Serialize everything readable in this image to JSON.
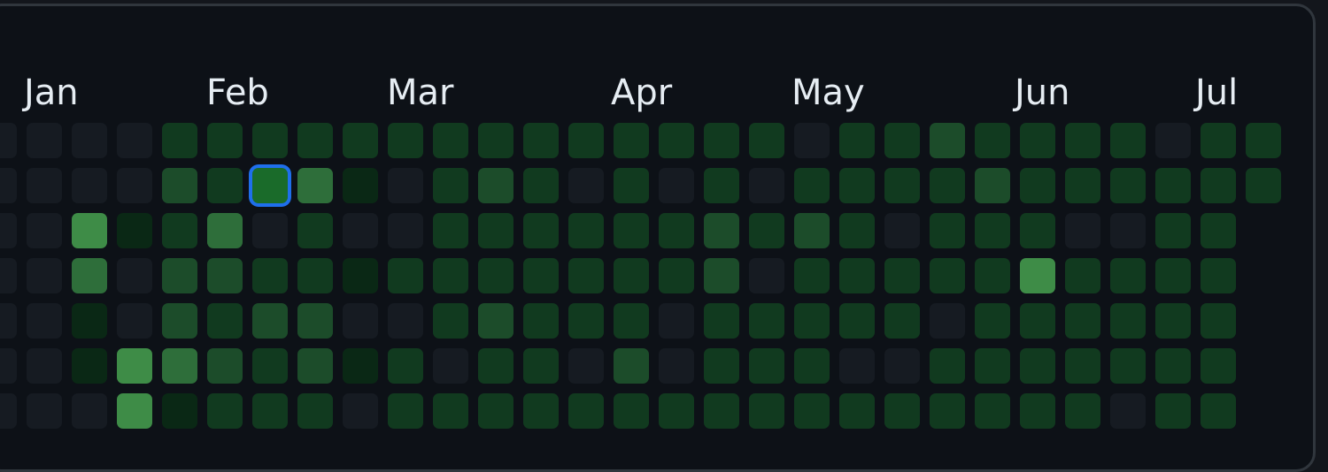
{
  "calendar": {
    "months": [
      "Jan",
      "Feb",
      "Mar",
      "Apr",
      "May",
      "Jun",
      "Jul"
    ],
    "colors": {
      "level0": "#161b22",
      "level1": "#0a2815",
      "level2": "#113a1f",
      "level3": "#1c4c2a",
      "level4": "#2e6e3a",
      "level5": "#3e8c47",
      "selected_outline": "#1f6feb",
      "selected_fill": "#1a6b2a"
    },
    "selected_week": 6,
    "selected_day": 1,
    "weeks": [
      [
        0,
        0,
        0,
        0,
        0,
        0,
        0
      ],
      [
        0,
        0,
        0,
        0,
        0,
        0,
        0
      ],
      [
        0,
        0,
        5,
        4,
        1,
        1,
        0
      ],
      [
        0,
        0,
        1,
        0,
        0,
        5,
        5
      ],
      [
        2,
        3,
        2,
        3,
        3,
        4,
        1
      ],
      [
        2,
        2,
        4,
        3,
        2,
        3,
        2
      ],
      [
        2,
        1,
        0,
        2,
        3,
        2,
        2
      ],
      [
        2,
        4,
        2,
        2,
        3,
        3,
        2
      ],
      [
        2,
        1,
        0,
        1,
        0,
        1,
        0
      ],
      [
        2,
        0,
        0,
        2,
        0,
        2,
        2
      ],
      [
        2,
        2,
        2,
        2,
        2,
        0,
        2
      ],
      [
        2,
        3,
        2,
        2,
        3,
        2,
        2
      ],
      [
        2,
        2,
        2,
        2,
        2,
        2,
        2
      ],
      [
        2,
        0,
        2,
        2,
        2,
        0,
        2
      ],
      [
        2,
        2,
        2,
        2,
        2,
        3,
        2
      ],
      [
        2,
        0,
        2,
        2,
        0,
        0,
        2
      ],
      [
        2,
        2,
        3,
        3,
        2,
        2,
        2
      ],
      [
        2,
        0,
        2,
        0,
        2,
        2,
        2
      ],
      [
        0,
        2,
        3,
        2,
        2,
        2,
        2
      ],
      [
        2,
        2,
        2,
        2,
        2,
        0,
        2
      ],
      [
        2,
        2,
        0,
        2,
        2,
        0,
        2
      ],
      [
        3,
        2,
        2,
        2,
        0,
        2,
        2
      ],
      [
        2,
        3,
        2,
        2,
        2,
        2,
        2
      ],
      [
        2,
        2,
        2,
        5,
        2,
        2,
        2
      ],
      [
        2,
        2,
        0,
        2,
        2,
        2,
        2
      ],
      [
        2,
        2,
        0,
        2,
        2,
        2,
        0
      ],
      [
        0,
        2,
        2,
        2,
        2,
        2,
        2
      ],
      [
        2,
        2,
        2,
        2,
        2,
        2,
        2
      ],
      [
        2,
        2
      ]
    ]
  }
}
